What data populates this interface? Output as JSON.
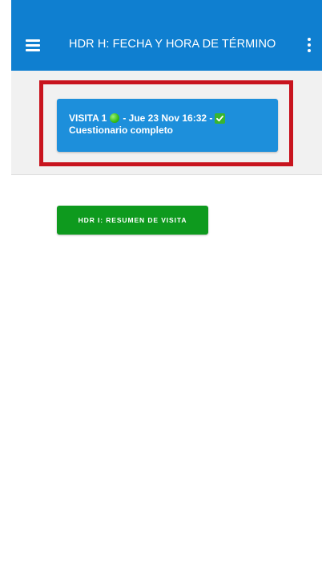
{
  "appbar": {
    "title": "HDR H: FECHA Y HORA DE TÉRMINO",
    "menu_icon": "hamburger-menu-icon",
    "more_icon": "more-vert-icon",
    "color": "#0f7fd0"
  },
  "visit": {
    "label": "VISITA 1",
    "status_icon": "green-dot-icon",
    "date_text": "- Jue 23 Nov 16:32 -",
    "complete_icon": "check-box-icon",
    "subtitle": "Cuestionario completo",
    "highlight_color": "#c8141e"
  },
  "actions": {
    "summary_label": "HDR I: RESUMEN DE VISITA",
    "summary_color": "#0e9a1e"
  }
}
